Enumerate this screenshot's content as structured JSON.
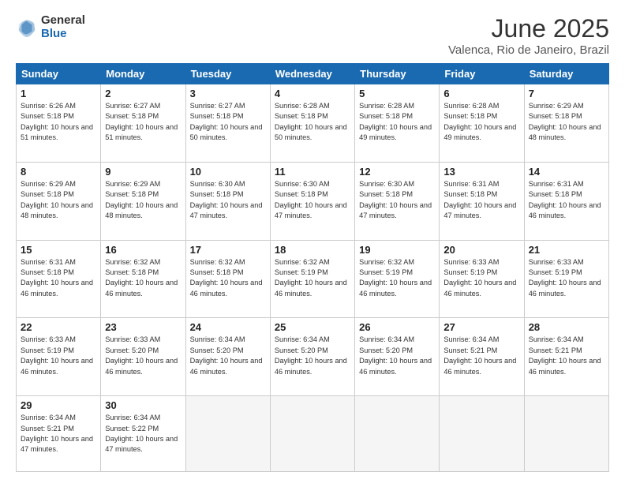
{
  "logo": {
    "general": "General",
    "blue": "Blue"
  },
  "title": "June 2025",
  "subtitle": "Valenca, Rio de Janeiro, Brazil",
  "headers": [
    "Sunday",
    "Monday",
    "Tuesday",
    "Wednesday",
    "Thursday",
    "Friday",
    "Saturday"
  ],
  "weeks": [
    [
      {
        "day": "1",
        "sunrise": "6:26 AM",
        "sunset": "5:18 PM",
        "daylight": "10 hours and 51 minutes."
      },
      {
        "day": "2",
        "sunrise": "6:27 AM",
        "sunset": "5:18 PM",
        "daylight": "10 hours and 51 minutes."
      },
      {
        "day": "3",
        "sunrise": "6:27 AM",
        "sunset": "5:18 PM",
        "daylight": "10 hours and 50 minutes."
      },
      {
        "day": "4",
        "sunrise": "6:28 AM",
        "sunset": "5:18 PM",
        "daylight": "10 hours and 50 minutes."
      },
      {
        "day": "5",
        "sunrise": "6:28 AM",
        "sunset": "5:18 PM",
        "daylight": "10 hours and 49 minutes."
      },
      {
        "day": "6",
        "sunrise": "6:28 AM",
        "sunset": "5:18 PM",
        "daylight": "10 hours and 49 minutes."
      },
      {
        "day": "7",
        "sunrise": "6:29 AM",
        "sunset": "5:18 PM",
        "daylight": "10 hours and 48 minutes."
      }
    ],
    [
      {
        "day": "8",
        "sunrise": "6:29 AM",
        "sunset": "5:18 PM",
        "daylight": "10 hours and 48 minutes."
      },
      {
        "day": "9",
        "sunrise": "6:29 AM",
        "sunset": "5:18 PM",
        "daylight": "10 hours and 48 minutes."
      },
      {
        "day": "10",
        "sunrise": "6:30 AM",
        "sunset": "5:18 PM",
        "daylight": "10 hours and 47 minutes."
      },
      {
        "day": "11",
        "sunrise": "6:30 AM",
        "sunset": "5:18 PM",
        "daylight": "10 hours and 47 minutes."
      },
      {
        "day": "12",
        "sunrise": "6:30 AM",
        "sunset": "5:18 PM",
        "daylight": "10 hours and 47 minutes."
      },
      {
        "day": "13",
        "sunrise": "6:31 AM",
        "sunset": "5:18 PM",
        "daylight": "10 hours and 47 minutes."
      },
      {
        "day": "14",
        "sunrise": "6:31 AM",
        "sunset": "5:18 PM",
        "daylight": "10 hours and 46 minutes."
      }
    ],
    [
      {
        "day": "15",
        "sunrise": "6:31 AM",
        "sunset": "5:18 PM",
        "daylight": "10 hours and 46 minutes."
      },
      {
        "day": "16",
        "sunrise": "6:32 AM",
        "sunset": "5:18 PM",
        "daylight": "10 hours and 46 minutes."
      },
      {
        "day": "17",
        "sunrise": "6:32 AM",
        "sunset": "5:18 PM",
        "daylight": "10 hours and 46 minutes."
      },
      {
        "day": "18",
        "sunrise": "6:32 AM",
        "sunset": "5:19 PM",
        "daylight": "10 hours and 46 minutes."
      },
      {
        "day": "19",
        "sunrise": "6:32 AM",
        "sunset": "5:19 PM",
        "daylight": "10 hours and 46 minutes."
      },
      {
        "day": "20",
        "sunrise": "6:33 AM",
        "sunset": "5:19 PM",
        "daylight": "10 hours and 46 minutes."
      },
      {
        "day": "21",
        "sunrise": "6:33 AM",
        "sunset": "5:19 PM",
        "daylight": "10 hours and 46 minutes."
      }
    ],
    [
      {
        "day": "22",
        "sunrise": "6:33 AM",
        "sunset": "5:19 PM",
        "daylight": "10 hours and 46 minutes."
      },
      {
        "day": "23",
        "sunrise": "6:33 AM",
        "sunset": "5:20 PM",
        "daylight": "10 hours and 46 minutes."
      },
      {
        "day": "24",
        "sunrise": "6:34 AM",
        "sunset": "5:20 PM",
        "daylight": "10 hours and 46 minutes."
      },
      {
        "day": "25",
        "sunrise": "6:34 AM",
        "sunset": "5:20 PM",
        "daylight": "10 hours and 46 minutes."
      },
      {
        "day": "26",
        "sunrise": "6:34 AM",
        "sunset": "5:20 PM",
        "daylight": "10 hours and 46 minutes."
      },
      {
        "day": "27",
        "sunrise": "6:34 AM",
        "sunset": "5:21 PM",
        "daylight": "10 hours and 46 minutes."
      },
      {
        "day": "28",
        "sunrise": "6:34 AM",
        "sunset": "5:21 PM",
        "daylight": "10 hours and 46 minutes."
      }
    ],
    [
      {
        "day": "29",
        "sunrise": "6:34 AM",
        "sunset": "5:21 PM",
        "daylight": "10 hours and 47 minutes."
      },
      {
        "day": "30",
        "sunrise": "6:34 AM",
        "sunset": "5:22 PM",
        "daylight": "10 hours and 47 minutes."
      },
      null,
      null,
      null,
      null,
      null
    ]
  ]
}
